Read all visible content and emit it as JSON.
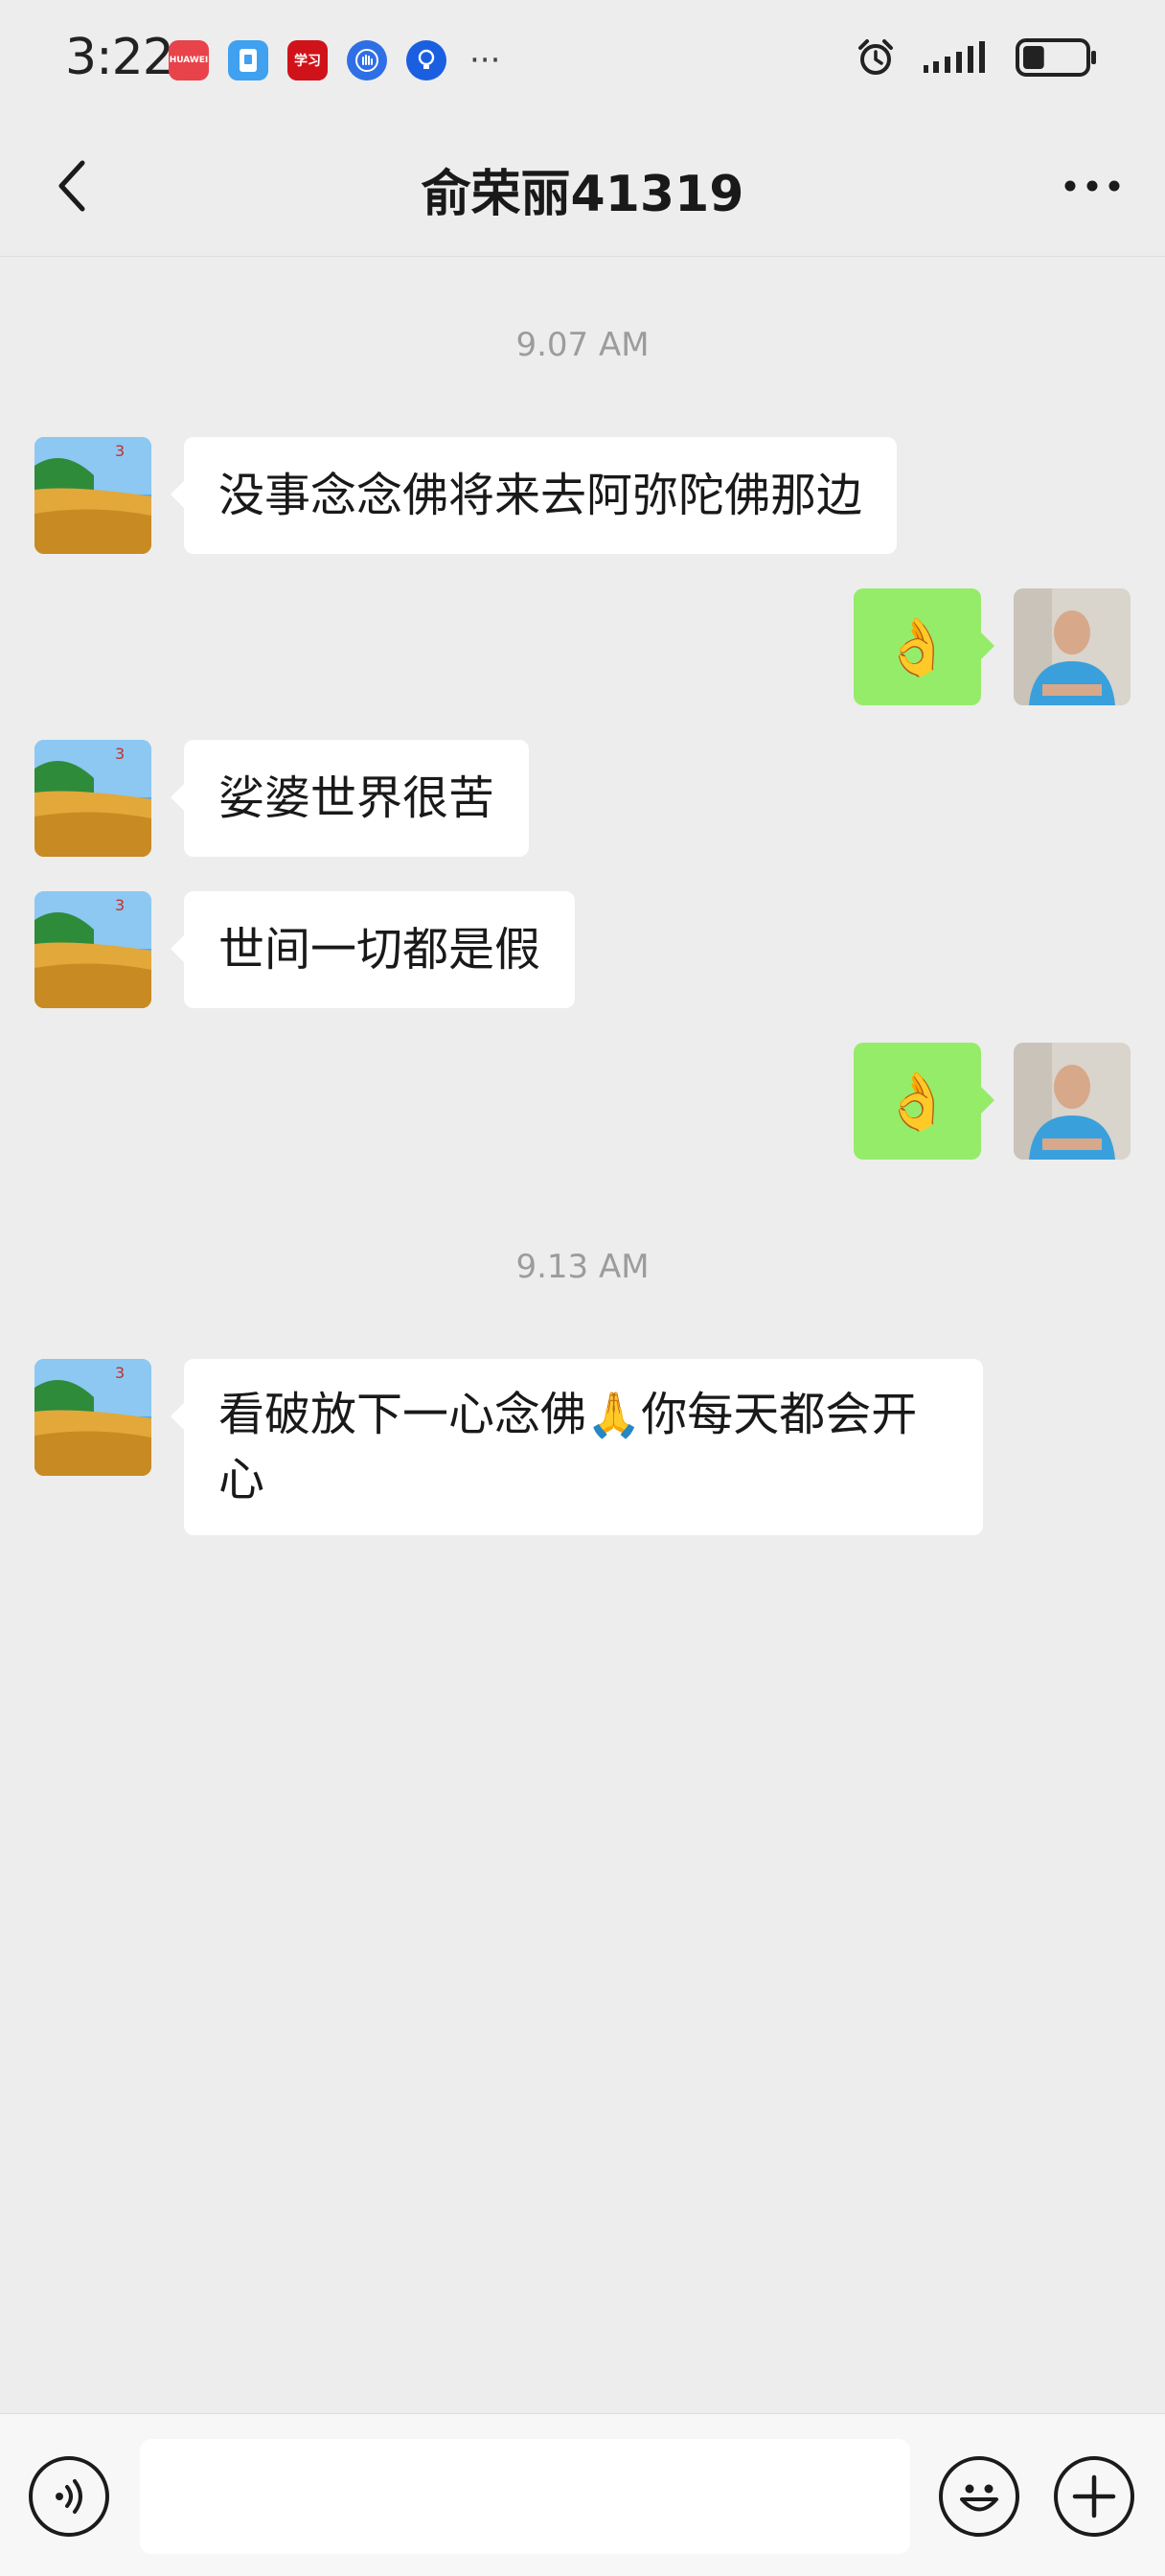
{
  "status_bar": {
    "time": "3:22",
    "more_indicator": "···",
    "notifications": [
      {
        "icon": "huawei-app-icon",
        "color": "#e8434a",
        "label": "HUAWEI"
      },
      {
        "icon": "wallet-app-icon",
        "color": "#3fa1f0"
      },
      {
        "icon": "xuexi-app-icon",
        "color": "#d0131a",
        "label": "学习"
      },
      {
        "icon": "hand-app-icon",
        "color": "#2f6fe6"
      },
      {
        "icon": "lightbulb-app-icon",
        "color": "#1a5fe0"
      }
    ],
    "right_icons": [
      "alarm-icon",
      "signal-icon",
      "battery-icon"
    ],
    "battery_level": 0.35
  },
  "header": {
    "title": "俞荣丽41319",
    "back_icon": "chevron-left-icon",
    "more_icon": "more-dots-icon"
  },
  "chat": {
    "timestamps": [
      "9.07 AM",
      "9.13 AM"
    ],
    "messages": [
      {
        "side": "in",
        "text": "没事念念佛将来去阿弥陀佛那边"
      },
      {
        "side": "out",
        "emoji": "👌"
      },
      {
        "side": "in",
        "text": "娑婆世界很苦"
      },
      {
        "side": "in",
        "text": "世间一切都是假"
      },
      {
        "side": "out",
        "emoji": "👌"
      },
      {
        "side": "in",
        "text_before": "看破放下一心念佛",
        "inline_emoji": "🙏",
        "text_after": "你每天都会开心"
      }
    ]
  },
  "input_bar": {
    "voice_icon": "voice-icon",
    "emoji_icon": "emoji-icon",
    "plus_icon": "plus-icon",
    "input_value": ""
  },
  "colors": {
    "background": "#ededed",
    "bubble_in": "#ffffff",
    "bubble_out": "#95ec69",
    "timestamp": "#9c9c9c"
  }
}
